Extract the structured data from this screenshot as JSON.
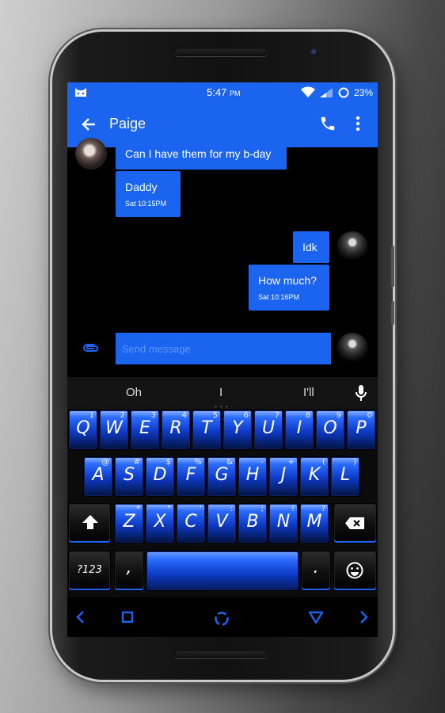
{
  "status_bar": {
    "time": "5:47",
    "ampm": "PM",
    "battery_pct": "23%"
  },
  "app_bar": {
    "title": "Paige"
  },
  "messages": [
    {
      "from": "contact",
      "text": "Can I have them for my b-day",
      "meta": ""
    },
    {
      "from": "contact",
      "text": "Daddy",
      "meta": "Sat 10:15PM"
    },
    {
      "from": "me",
      "text": "Idk",
      "meta": ""
    },
    {
      "from": "me",
      "text": "How much?",
      "meta": "Sat 10:16PM"
    }
  ],
  "compose": {
    "placeholder": "Send message"
  },
  "suggestions": [
    "Oh",
    "I",
    "I'll"
  ],
  "keyboard": {
    "row1": [
      {
        "k": "Q",
        "h": "1"
      },
      {
        "k": "W",
        "h": "2"
      },
      {
        "k": "E",
        "h": "3"
      },
      {
        "k": "R",
        "h": "4"
      },
      {
        "k": "T",
        "h": "5"
      },
      {
        "k": "Y",
        "h": "6"
      },
      {
        "k": "U",
        "h": "7"
      },
      {
        "k": "I",
        "h": "8"
      },
      {
        "k": "O",
        "h": "9"
      },
      {
        "k": "P",
        "h": "0"
      }
    ],
    "row2": [
      {
        "k": "A",
        "h": "@"
      },
      {
        "k": "S",
        "h": "#"
      },
      {
        "k": "D",
        "h": "$"
      },
      {
        "k": "F",
        "h": "%"
      },
      {
        "k": "G",
        "h": "&"
      },
      {
        "k": "H",
        "h": "-"
      },
      {
        "k": "J",
        "h": "+"
      },
      {
        "k": "K",
        "h": "("
      },
      {
        "k": "L",
        "h": ")"
      }
    ],
    "row3": [
      {
        "k": "Z",
        "h": "*"
      },
      {
        "k": "X",
        "h": "\""
      },
      {
        "k": "C",
        "h": "'"
      },
      {
        "k": "V",
        "h": ":"
      },
      {
        "k": "B",
        "h": ";"
      },
      {
        "k": "N",
        "h": "!"
      },
      {
        "k": "M",
        "h": "?"
      }
    ],
    "symbols_label": "?123",
    "comma": ",",
    "period": "."
  },
  "colors": {
    "accent": "#1a64f0",
    "background": "#000000"
  }
}
